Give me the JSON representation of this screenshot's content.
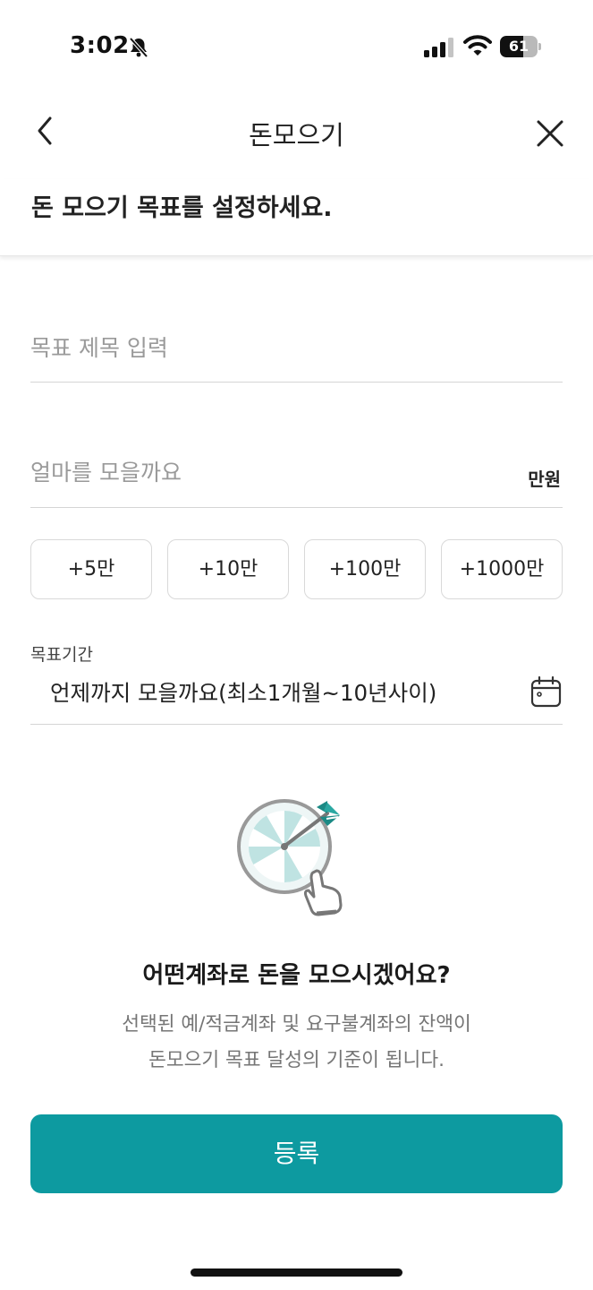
{
  "status_bar": {
    "time": "3:02",
    "battery": "61",
    "battery_level": 0.61
  },
  "nav": {
    "title": "돈모으기"
  },
  "subtitle": "돈 모으기 목표를 설정하세요.",
  "form": {
    "goal_placeholder": "목표 제목 입력",
    "amount_placeholder": "얼마를 모을까요",
    "amount_unit": "만원",
    "chips": [
      "+5만",
      "+10만",
      "+100만",
      "+1000만"
    ],
    "period_label": "목표기간",
    "period_placeholder": "언제까지 모을까요(최소1개월~10년사이)"
  },
  "info": {
    "question": "어떤계좌로 돈을 모으시겠어요?",
    "desc_line1": "선택된 예/적금계좌 및 요구불계좌의 잔액이",
    "desc_line2": "돈모으기 목표 달성의 기준이 됩니다."
  },
  "register_label": "등록",
  "colors": {
    "accent": "#0d9aa0",
    "divider": "#d5d5d5",
    "placeholder": "#9a9a9a"
  },
  "icons": [
    "bell-slash-icon",
    "signal-icon",
    "wifi-icon",
    "battery-icon",
    "back-chevron-icon",
    "close-icon",
    "calendar-icon",
    "target-arrow-illustration"
  ]
}
